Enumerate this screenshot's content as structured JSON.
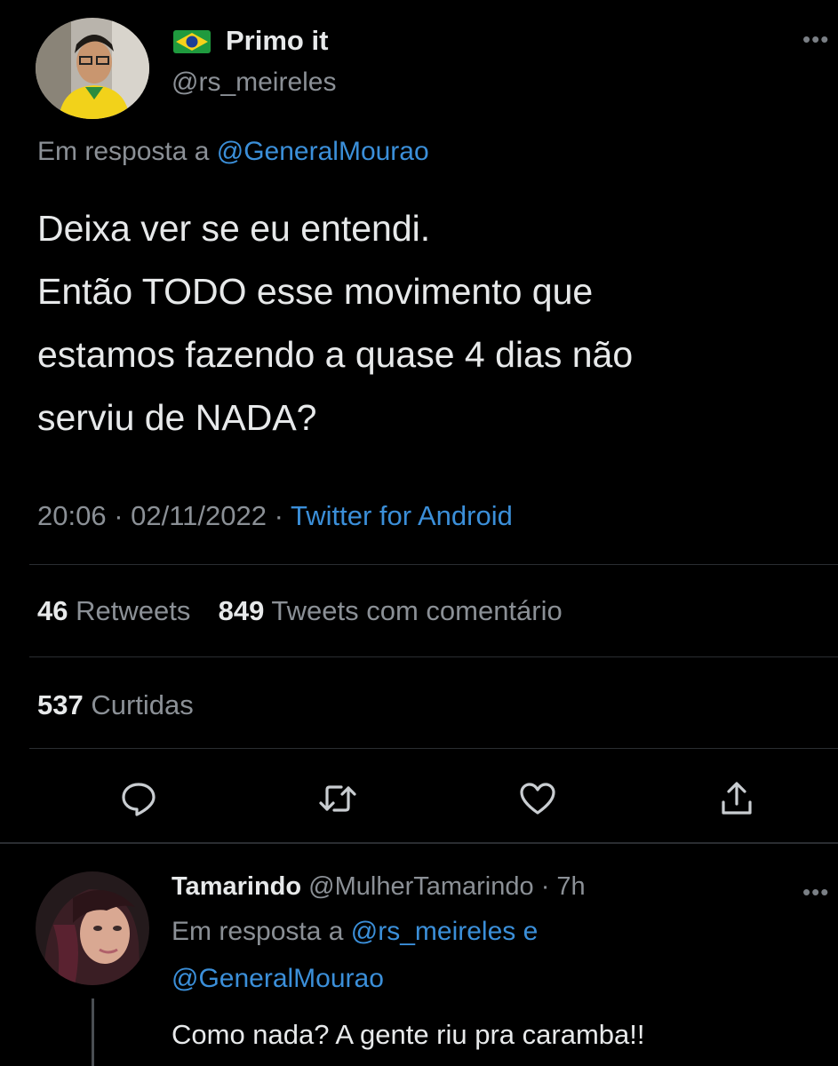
{
  "main_tweet": {
    "display_name": "Primo it",
    "flag_icon": "brazil-flag-icon",
    "handle": "@rs_meireles",
    "reply_prefix": "Em resposta a",
    "reply_to": "@GeneralMourao",
    "text_lines": [
      "Deixa ver se eu entendi.",
      "Então TODO esse movimento que",
      "estamos fazendo a quase 4 dias não",
      "serviu de NADA?"
    ],
    "time": "20:06",
    "date": "02/11/2022",
    "source": "Twitter for Android",
    "retweets_count": "46",
    "retweets_label": "Retweets",
    "quotes_count": "849",
    "quotes_label": "Tweets com comentário",
    "likes_count": "537",
    "likes_label": "Curtidas",
    "actions": [
      "reply-icon",
      "retweet-icon",
      "like-icon",
      "share-icon"
    ]
  },
  "reply_tweet": {
    "display_name": "Tamarindo",
    "handle": "@MulherTamarindo",
    "age": "7h",
    "reply_prefix": "Em resposta a",
    "reply_to_1": "@rs_meireles",
    "reply_conjunction": "e",
    "reply_to_2": "@GeneralMourao",
    "text": "Como nada? A gente riu pra caramba!!"
  },
  "colors": {
    "background": "#000000",
    "text": "#e7e9ea",
    "muted": "#8b9096",
    "link": "#3b8fd9",
    "divider": "#2a2d31"
  }
}
